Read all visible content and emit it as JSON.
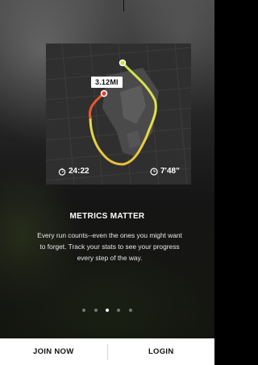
{
  "map": {
    "distance_badge": "3.12MI",
    "elapsed_time": "24:22",
    "pace": "7'48\"",
    "route_colors": {
      "start": "#c8e24a",
      "mid": "#e6e24a",
      "end": "#e5452c"
    }
  },
  "onboarding": {
    "headline": "METRICS MATTER",
    "body": "Every run counts--even the ones you might want to forget. Track your stats to see your progress every step of the way.",
    "page_count": 5,
    "active_page": 3
  },
  "bottom_bar": {
    "join_label": "JOIN NOW",
    "login_label": "LOGIN"
  },
  "icons": {
    "stopwatch": "stopwatch-icon",
    "pace_clock": "clock-icon"
  }
}
